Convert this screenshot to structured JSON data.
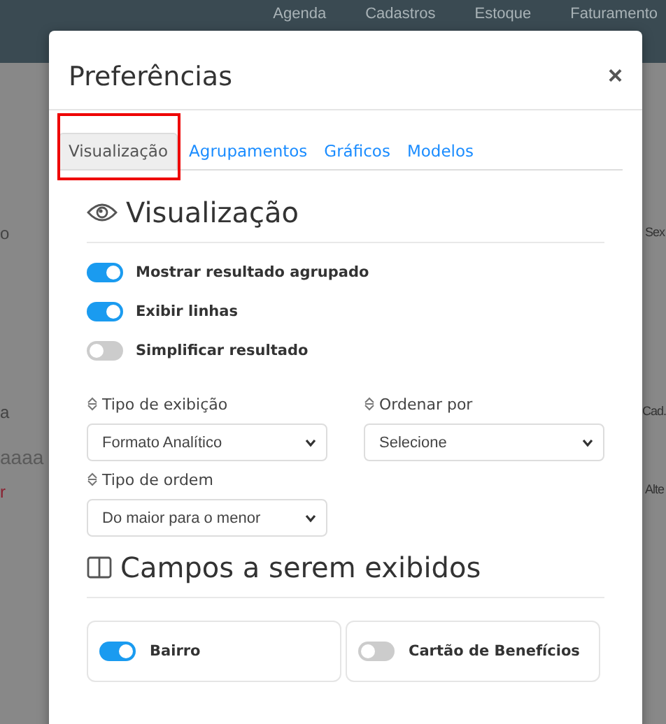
{
  "nav": {
    "items": [
      "Agenda",
      "Cadastros",
      "Estoque",
      "Faturamento"
    ]
  },
  "background": {
    "left_fragments": [
      {
        "text": "o",
        "kind": "label"
      },
      {
        "text": "a",
        "kind": "label"
      },
      {
        "text": "aaaa",
        "kind": "input"
      },
      {
        "text": "r",
        "kind": "error"
      }
    ],
    "right_fragments": [
      {
        "text": "Sex"
      },
      {
        "text": "Cad."
      },
      {
        "text": "Alte"
      }
    ]
  },
  "modal": {
    "title": "Preferências",
    "close": "×",
    "tabs": [
      {
        "label": "Visualização",
        "selected": true,
        "highlighted": true
      },
      {
        "label": "Agrupamentos",
        "selected": false,
        "highlighted": false
      },
      {
        "label": "Gráficos",
        "selected": false,
        "highlighted": false
      },
      {
        "label": "Modelos",
        "selected": false,
        "highlighted": false
      }
    ],
    "view_section": {
      "title": "Visualização",
      "toggles": [
        {
          "label": "Mostrar resultado agrupado",
          "on": true
        },
        {
          "label": "Exibir linhas",
          "on": true
        },
        {
          "label": "Simplificar resultado",
          "on": false
        }
      ],
      "selects": [
        {
          "label": "Tipo de exibição",
          "value": "Formato Analítico"
        },
        {
          "label": "Ordenar por",
          "value": "Selecione"
        },
        {
          "label": "Tipo de ordem",
          "value": "Do maior para o menor"
        }
      ]
    },
    "fields_section": {
      "title": "Campos a serem exibidos",
      "fields": [
        {
          "label": "Bairro",
          "on": true
        },
        {
          "label": "Cartão de Benefícios",
          "on": false
        }
      ]
    }
  }
}
